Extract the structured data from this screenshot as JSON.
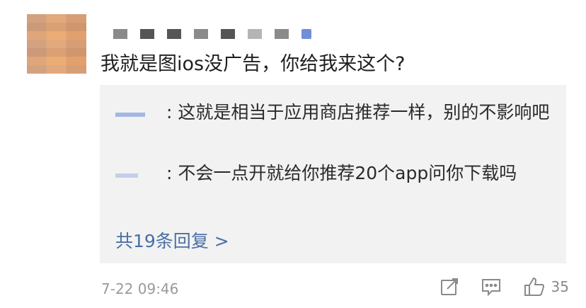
{
  "comment": {
    "text": "我就是图ios没广告，你给我来这个?"
  },
  "replies": [
    {
      "text": ": 这就是相当于应用商店推荐一样，别的不影响吧"
    },
    {
      "text": ": 不会一点开就给你推荐20个app问你下载吗"
    }
  ],
  "more_replies": "共19条回复 >",
  "meta": {
    "timestamp": "7-22 09:46",
    "like_count": "35"
  },
  "icons": {
    "share": "share-icon",
    "comment": "comment-icon",
    "like": "thumbs-up-icon"
  }
}
